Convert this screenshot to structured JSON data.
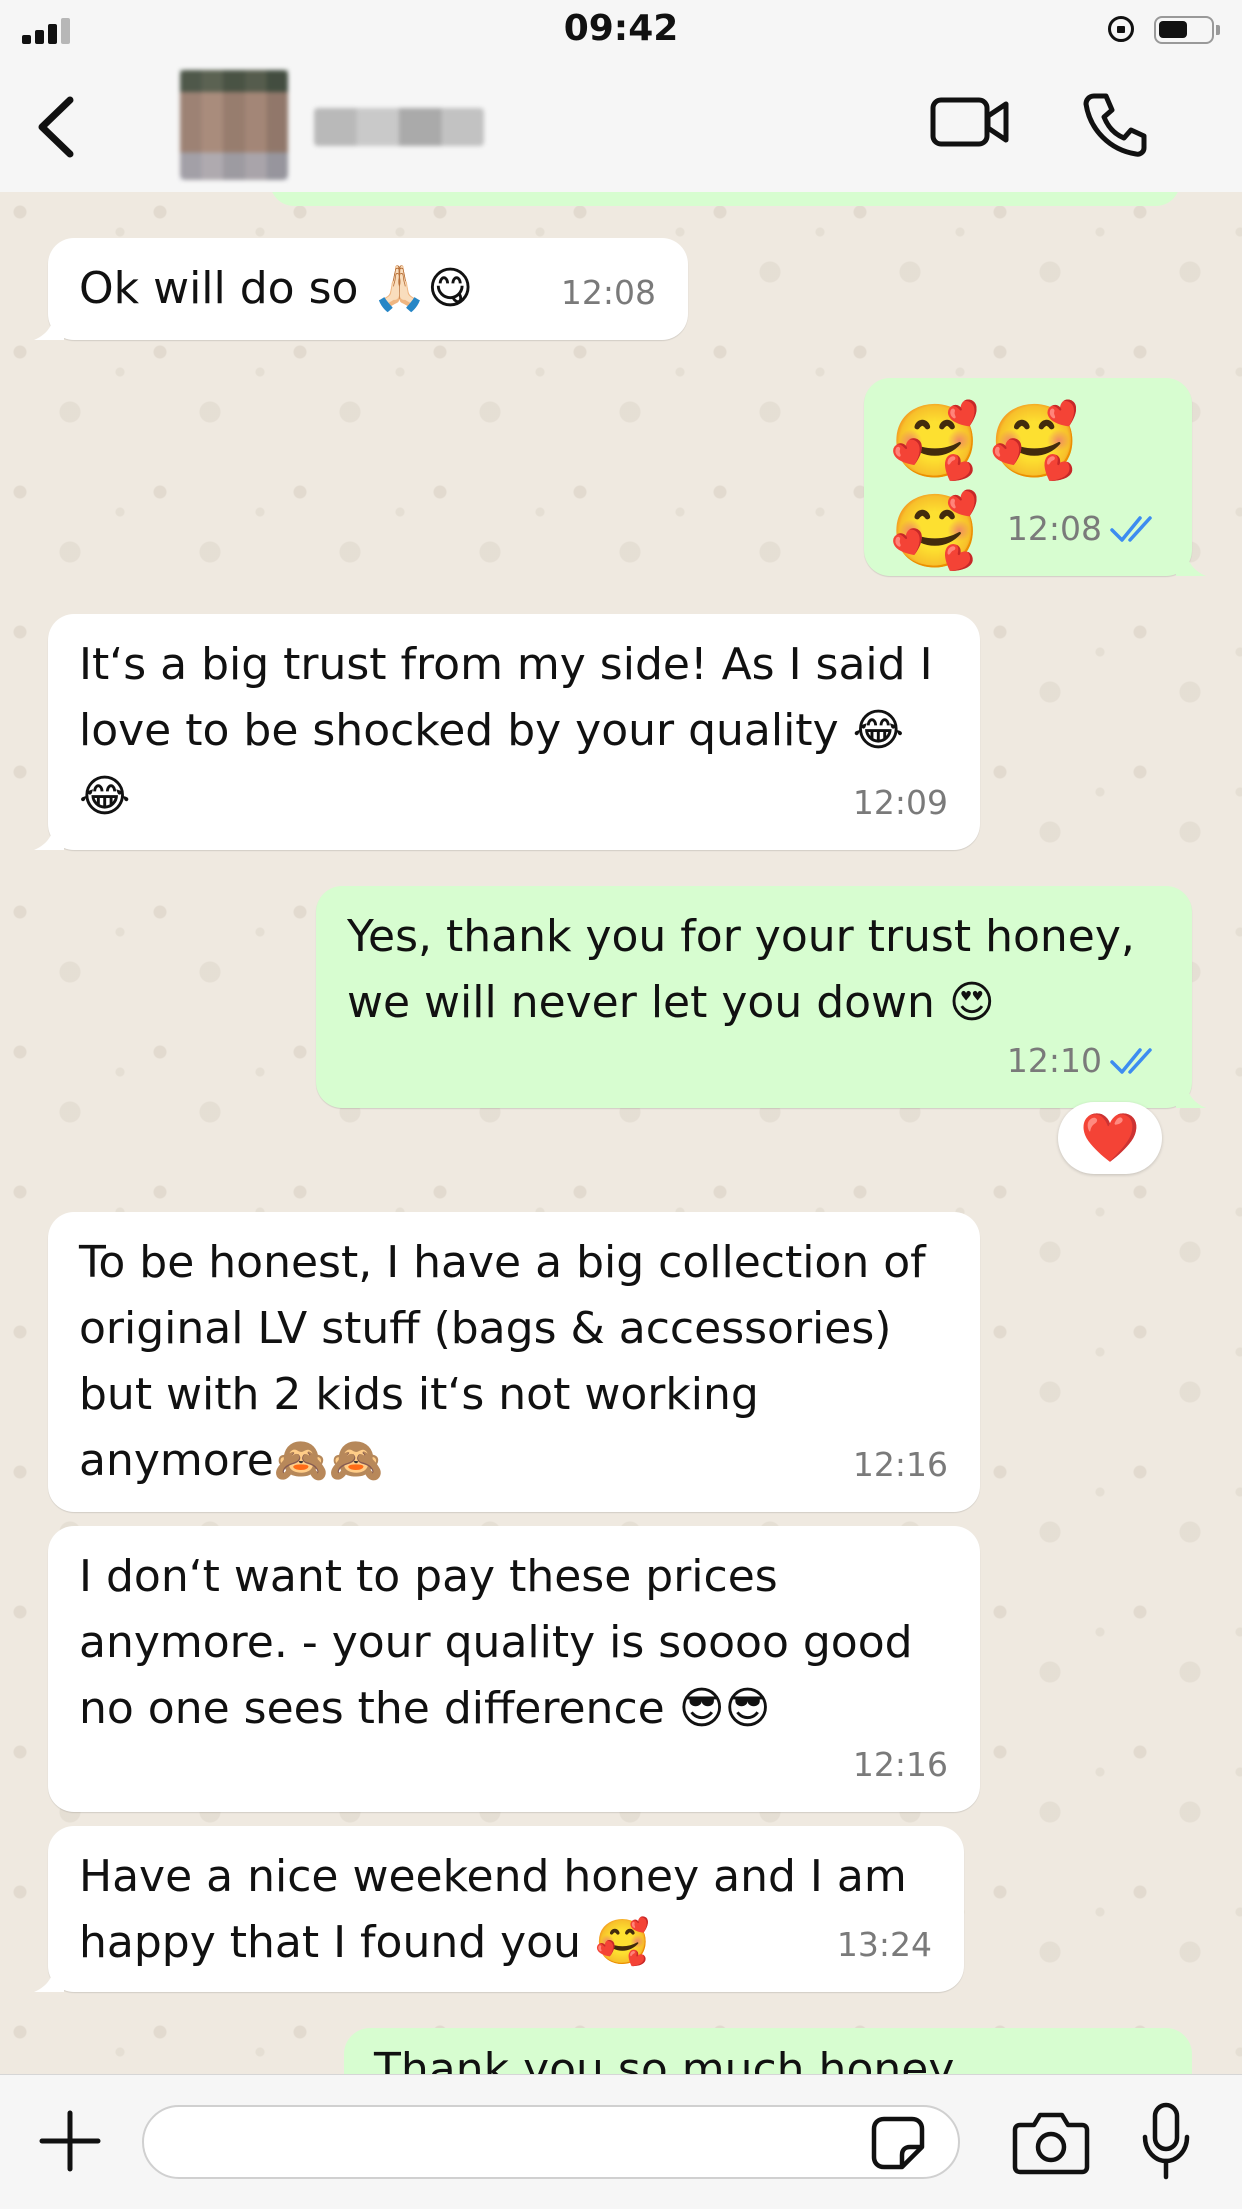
{
  "status_bar": {
    "time": "09:42",
    "battery_level": 0.55,
    "signal_bars": 3
  },
  "header": {
    "back_icon": "chevron-left-icon",
    "contact_name": "",
    "avatar": "blurred-photo",
    "actions": [
      "video-call-icon",
      "phone-call-icon"
    ]
  },
  "messages": [
    {
      "direction": "in",
      "text": "Ok will do so 🙏🏻😋",
      "time": "12:08"
    },
    {
      "direction": "out",
      "text": "🥰🥰🥰",
      "time": "12:08",
      "status": "read"
    },
    {
      "direction": "in",
      "text": "It‘s a big trust from my side! As I said I\nlove to be shocked by your quality 😂\n😂",
      "time": "12:09"
    },
    {
      "direction": "out",
      "text": "Yes, thank you for your trust honey,\nwe will never let you down 😍",
      "time": "12:10",
      "status": "read",
      "reaction": "❤️"
    },
    {
      "direction": "in",
      "text": "To be honest, I have a big collection of\noriginal LV stuff (bags & accessories)\nbut with 2 kids it‘s not working\nanymore🙈🙈",
      "time": "12:16"
    },
    {
      "direction": "in",
      "text": "I don‘t want to pay these prices\nanymore. - your quality is soooo good\nno one sees the difference 😎😎",
      "time": "12:16"
    },
    {
      "direction": "in",
      "text": "Have a nice weekend honey and I am\nhappy that I found you 🥰",
      "time": "13:24"
    },
    {
      "direction": "out",
      "text": "Thank you so much honey",
      "time": "",
      "status": "partial"
    }
  ],
  "input_bar": {
    "placeholder": "",
    "icons": [
      "plus-icon",
      "sticker-icon",
      "camera-icon",
      "microphone-icon"
    ]
  },
  "colors": {
    "incoming_bubble": "#ffffff",
    "outgoing_bubble": "#d7fdd0",
    "read_ticks": "#3d8cf0",
    "wallpaper": "#efe9e0",
    "bar_background": "#f6f6f6"
  }
}
